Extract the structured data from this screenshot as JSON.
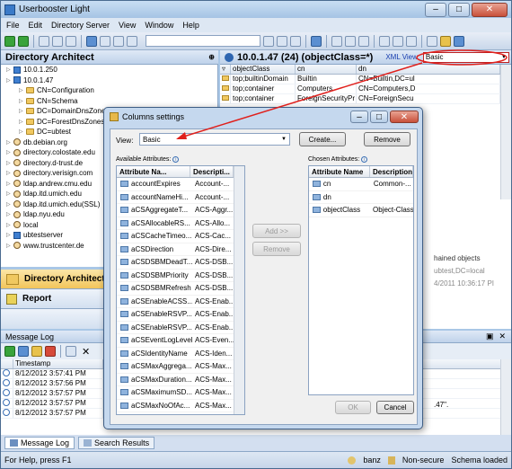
{
  "app": {
    "title": "Userbooster Light"
  },
  "menu": [
    "File",
    "Edit",
    "Directory Server",
    "View",
    "Window",
    "Help"
  ],
  "left": {
    "header": "Directory Architect",
    "tree": [
      {
        "label": "10.0.1.250",
        "type": "srv",
        "indent": 1
      },
      {
        "label": "10.0.1.47",
        "type": "srv",
        "indent": 1
      },
      {
        "label": "CN=Configuration",
        "type": "fold",
        "indent": 2
      },
      {
        "label": "CN=Schema",
        "type": "fold",
        "indent": 2
      },
      {
        "label": "DC=DomainDnsZones",
        "type": "fold",
        "indent": 2
      },
      {
        "label": "DC=ForestDnsZones",
        "type": "fold",
        "indent": 2
      },
      {
        "label": "DC=ubtest",
        "type": "fold",
        "indent": 2
      },
      {
        "label": "db.debian.org",
        "type": "user",
        "indent": 1
      },
      {
        "label": "directory.colostate.edu",
        "type": "user",
        "indent": 1
      },
      {
        "label": "directory.d-trust.de",
        "type": "user",
        "indent": 1
      },
      {
        "label": "directory.verisign.com",
        "type": "user",
        "indent": 1
      },
      {
        "label": "ldap.andrew.cmu.edu",
        "type": "user",
        "indent": 1
      },
      {
        "label": "ldap.itd.umich.edu",
        "type": "user",
        "indent": 1
      },
      {
        "label": "ldap.itd.umich.edu(SSL)",
        "type": "user",
        "indent": 1
      },
      {
        "label": "ldap.nyu.edu",
        "type": "user",
        "indent": 1
      },
      {
        "label": "local",
        "type": "user",
        "indent": 1
      },
      {
        "label": "ubtestserver",
        "type": "srv",
        "indent": 1
      },
      {
        "label": "www.trustcenter.de",
        "type": "user",
        "indent": 1
      }
    ],
    "nav_directory": "Directory Architect",
    "nav_report": "Report"
  },
  "right": {
    "heading": "10.0.1.47 (24) (objectClass=*)",
    "xml_view": "XML View",
    "view_value": "Basic",
    "columns": [
      "objectClass",
      "cn",
      "dn"
    ],
    "rows": [
      [
        "top;builtinDomain",
        "Builtin",
        "CN=Builtin,DC=ul"
      ],
      [
        "top;container",
        "Computers",
        "CN=Computers,D"
      ],
      [
        "top;container",
        "ForeignSecurityPr",
        "CN=ForeignSecu"
      ]
    ],
    "side_text": [
      "hained objects",
      "ubtest,DC=local",
      "4/2011 10:36:17 PI"
    ]
  },
  "log": {
    "title": "Message Log",
    "col": "Timestamp",
    "rows": [
      "8/12/2012 3:57:41 PM",
      "8/12/2012 3:57:56 PM",
      "8/12/2012 3:57:57 PM",
      "8/12/2012 3:57:57 PM",
      "8/12/2012 3:57:57 PM"
    ],
    "tail": ".47\"."
  },
  "tabs": [
    "Message Log",
    "Search Results"
  ],
  "status": {
    "left": "For Help, press F1",
    "user": "banz",
    "security": "Non-secure",
    "schema": "Schema loaded"
  },
  "dialog": {
    "title": "Columns settings",
    "view_label": "View:",
    "view_value": "Basic",
    "create": "Create...",
    "remove": "Remove",
    "available_label": "Available Attributes:",
    "chosen_label": "Chosen Attributes:",
    "add": "Add >>",
    "remove_small": "Remove",
    "ok": "OK",
    "cancel": "Cancel",
    "avail_head": [
      "Attribute Na...",
      "Descripti..."
    ],
    "chosen_head": [
      "Attribute Name",
      "Description"
    ],
    "available": [
      [
        "accountExpires",
        "Account-..."
      ],
      [
        "accountNameHi...",
        "Account-..."
      ],
      [
        "aCSAggregateT...",
        "ACS-Aggr..."
      ],
      [
        "aCSAllocableRS...",
        "ACS-Allo..."
      ],
      [
        "aCSCacheTimeo...",
        "ACS-Cac..."
      ],
      [
        "aCSDirection",
        "ACS-Dire..."
      ],
      [
        "aCSDSBMDeadT...",
        "ACS-DSB..."
      ],
      [
        "aCSDSBMPriority",
        "ACS-DSB..."
      ],
      [
        "aCSDSBMRefresh",
        "ACS-DSB..."
      ],
      [
        "aCSEnableACSS...",
        "ACS-Enab..."
      ],
      [
        "aCSEnableRSVP...",
        "ACS-Enab..."
      ],
      [
        "aCSEnableRSVP...",
        "ACS-Enab..."
      ],
      [
        "aCSEventLogLevel",
        "ACS-Even..."
      ],
      [
        "aCSIdentityName",
        "ACS-Iden..."
      ],
      [
        "aCSMaxAggrega...",
        "ACS-Max..."
      ],
      [
        "aCSMaxDuration...",
        "ACS-Max..."
      ],
      [
        "aCSMaximumSD...",
        "ACS-Max..."
      ],
      [
        "aCSMaxNoOfAc...",
        "ACS-Max..."
      ]
    ],
    "chosen": [
      [
        "cn",
        "Common-..."
      ],
      [
        "dn",
        ""
      ],
      [
        "objectClass",
        "Object-Class"
      ]
    ]
  }
}
